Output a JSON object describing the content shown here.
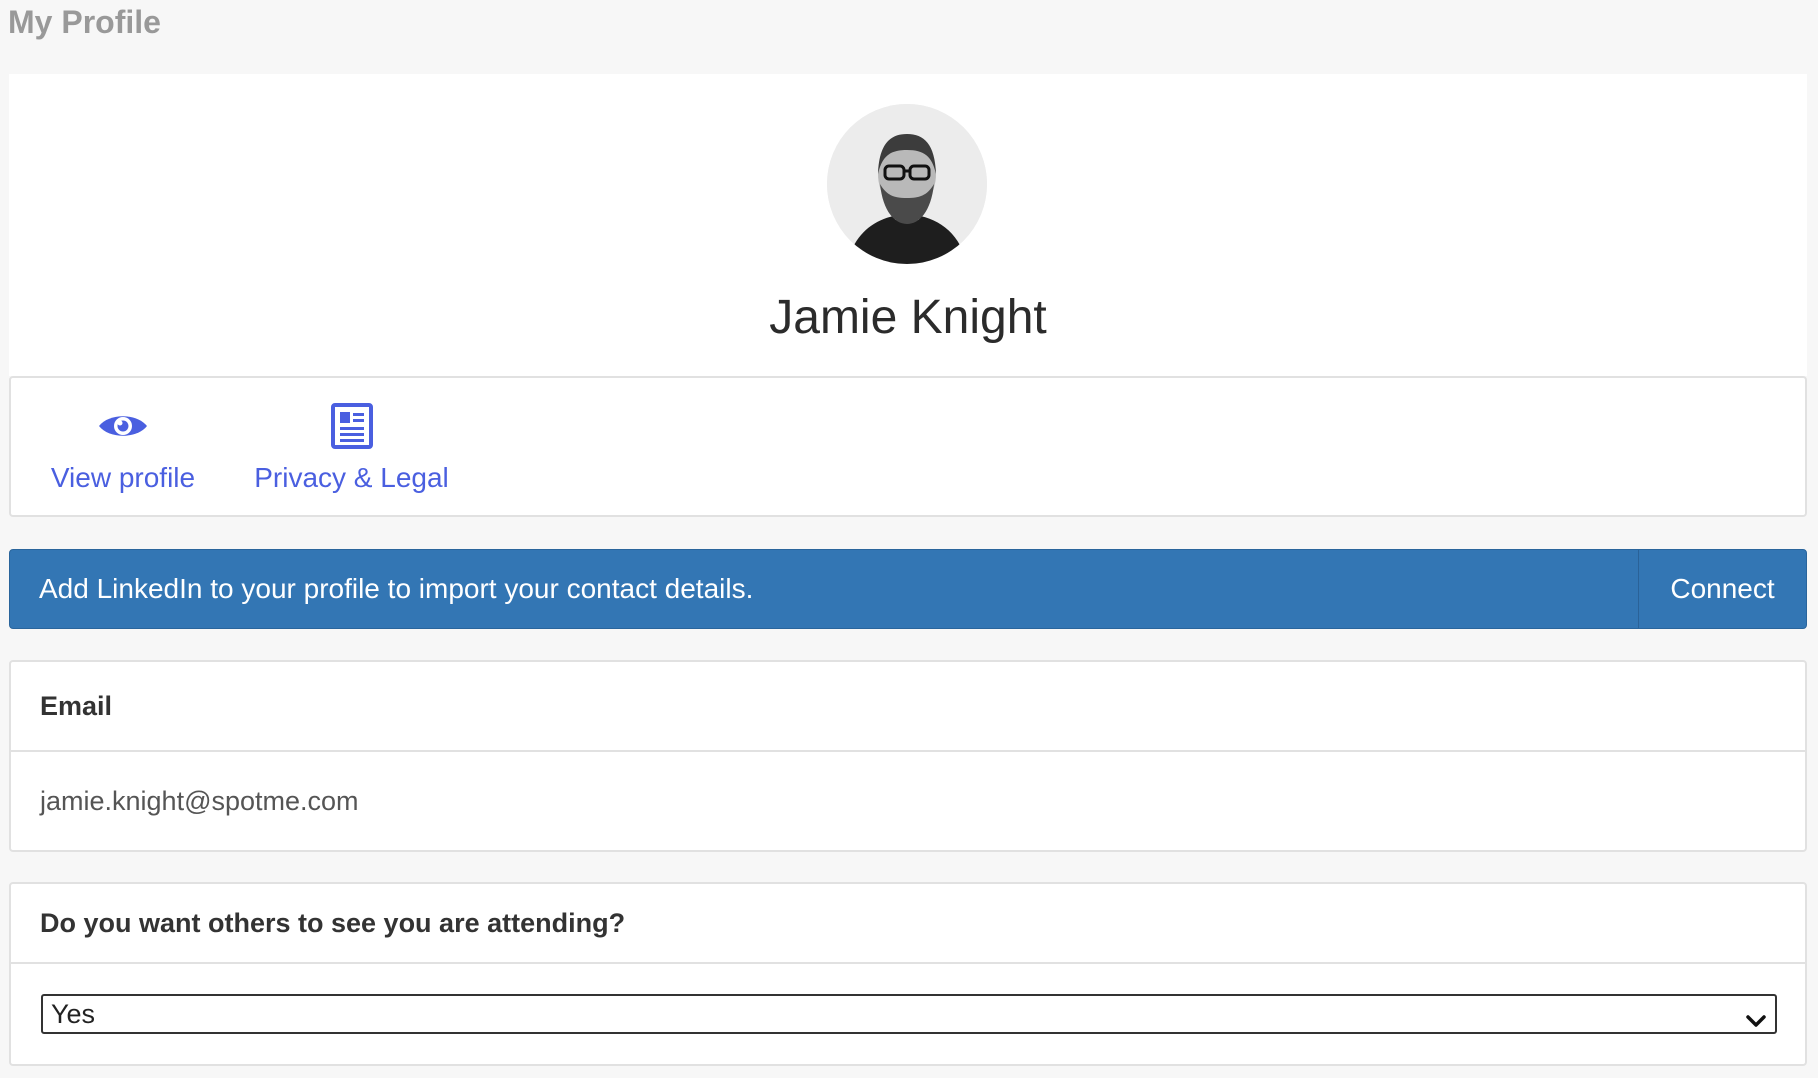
{
  "page": {
    "title": "My Profile"
  },
  "profile": {
    "name": "Jamie Knight",
    "avatar_icon": "profile-photo"
  },
  "actions": {
    "view_profile": {
      "label": "View profile",
      "icon": "eye-icon"
    },
    "privacy_legal": {
      "label": "Privacy & Legal",
      "icon": "document-icon"
    }
  },
  "linkedin": {
    "message": "Add LinkedIn to your profile to import your contact details.",
    "connect_label": "Connect",
    "color": "#3376b4"
  },
  "email": {
    "label": "Email",
    "value": "jamie.knight@spotme.com"
  },
  "attendance": {
    "label": "Do you want others to see you are attending?",
    "selected": "Yes"
  },
  "colors": {
    "accent": "#4a5fe0",
    "background": "#f7f7f7"
  }
}
